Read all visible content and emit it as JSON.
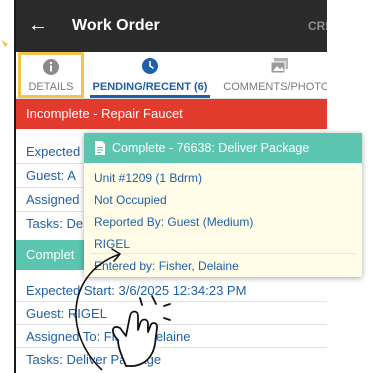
{
  "appbar": {
    "title": "Work Order",
    "back_icon": "back-arrow-icon",
    "create_label": "CREATE"
  },
  "tabs": [
    {
      "label": "DETAILS",
      "icon": "info-icon"
    },
    {
      "label": "PENDING/RECENT (6)",
      "icon": "clock-icon"
    },
    {
      "label": "COMMENTS/PHOTOS",
      "icon": "photos-icon"
    }
  ],
  "incomplete_banner": {
    "text": "Incomplete - Repair Faucet",
    "color": "#e23a2d"
  },
  "first_item": {
    "expected": "Expected",
    "guest": "Guest: A",
    "assigned": "Assigned",
    "tasks": "Tasks: De"
  },
  "complete_banner": {
    "text": "Complet",
    "color": "#5cc5b0"
  },
  "second_item": {
    "expected_start": "Expected Start: 3/6/2025 12:34:23 PM",
    "guest": "Guest: RIGEL",
    "assigned": "Assigned To: Fisher, Delaine",
    "tasks": "Tasks: Deliver Package"
  },
  "popup": {
    "title": "Complete - 76638: Deliver Package",
    "icon": "document-icon",
    "unit": "Unit #1209 (1 Bdrm)",
    "occupancy": "Not Occupied",
    "reported_by": "Reported By: Guest  (Medium)",
    "guest_name": "RIGEL",
    "entered_by": "Entered by: Fisher, Delaine"
  },
  "overlay": {
    "gesture_icon": "tap-hand-icon"
  }
}
